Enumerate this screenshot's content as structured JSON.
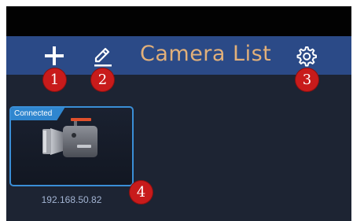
{
  "nav": {
    "title": "Camera List",
    "add_icon": "plus-icon",
    "edit_icon": "pencil-icon",
    "settings_icon": "gear-icon"
  },
  "badges": [
    "1",
    "2",
    "3",
    "4"
  ],
  "cameras": [
    {
      "status": "Connected",
      "ip": "192.168.50.82",
      "icon": "video-camera-icon"
    }
  ],
  "colors": {
    "status_bar": "#020202",
    "nav_bar": "#2b4a87",
    "title": "#e2b07a",
    "background": "#1d2433",
    "accent": "#2f86cf",
    "badge": "#c81b1b"
  }
}
